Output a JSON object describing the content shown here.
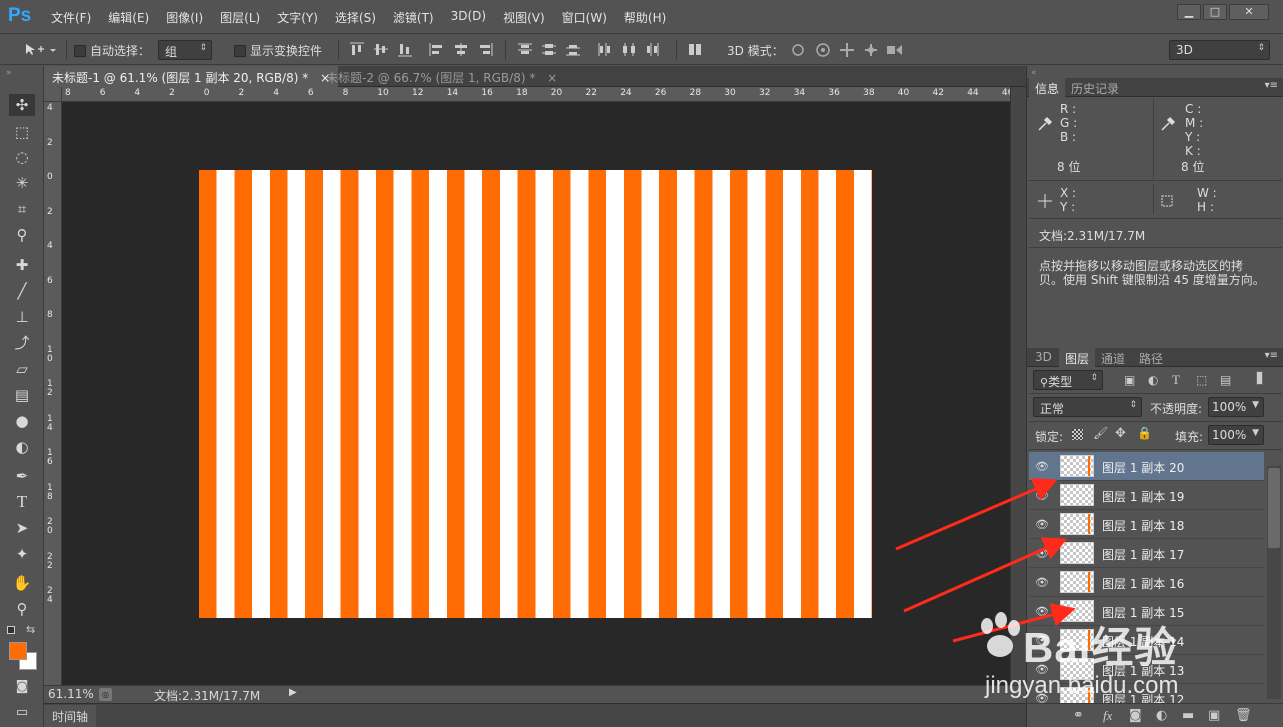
{
  "app": {
    "logo": "Ps"
  },
  "menu": [
    "文件(F)",
    "编辑(E)",
    "图像(I)",
    "图层(L)",
    "文字(Y)",
    "选择(S)",
    "滤镜(T)",
    "3D(D)",
    "视图(V)",
    "窗口(W)",
    "帮助(H)"
  ],
  "window_controls": {
    "minimize": "▁",
    "maximize": "□",
    "close": "✕"
  },
  "options": {
    "auto_select_label": "自动选择：",
    "auto_select_value": "组",
    "show_transform_label": "显示变换控件",
    "mode_3d_label": "3D 模式：",
    "workspace_value": "3D"
  },
  "doc_tabs": [
    {
      "title": "未标题-1 @ 61.1% (图层 1 副本 20, RGB/8) *",
      "close": "×",
      "active": true
    },
    {
      "title": "未标题-2 @ 66.7% (图层 1, RGB/8) *",
      "close": "×",
      "active": false
    }
  ],
  "ruler": {
    "h_labels": [
      "8",
      "6",
      "4",
      "2",
      "0",
      "2",
      "4",
      "6",
      "8",
      "10",
      "12",
      "14",
      "16",
      "18",
      "20",
      "22",
      "24",
      "26",
      "28",
      "30",
      "32",
      "34",
      "36",
      "38",
      "40",
      "42",
      "44",
      "46"
    ],
    "v_labels": [
      "4",
      "2",
      "0",
      "2",
      "4",
      "6",
      "8",
      "1\n0",
      "1\n2",
      "1\n4",
      "1\n6",
      "1\n8",
      "2\n0",
      "2\n2",
      "2\n4"
    ]
  },
  "status": {
    "zoom": "61.11%",
    "doc_size": "文档:2.31M/17.7M",
    "timeline_tab": "时间轴"
  },
  "info_panel": {
    "tabs": [
      "信息",
      "历史记录"
    ],
    "rgb": [
      "R :",
      "G :",
      "B :"
    ],
    "cmyk": [
      "C :",
      "M :",
      "Y :",
      "K :"
    ],
    "bits_left": "8 位",
    "bits_right": "8 位",
    "xy": [
      "X :",
      "Y :"
    ],
    "wh": [
      "W :",
      "H :"
    ],
    "doc_size": "文档:2.31M/17.7M",
    "hint_line1": "点按并拖移以移动图层或移动选区的拷",
    "hint_line2": "贝。使用 Shift 键限制沿 45 度增量方向。"
  },
  "layers_panel": {
    "tabs": [
      "3D",
      "图层",
      "通道",
      "路径"
    ],
    "filter_kind": "类型",
    "blend_mode": "正常",
    "opacity_label": "不透明度:",
    "opacity_value": "100%",
    "lock_label": "锁定:",
    "fill_label": "填充:",
    "fill_value": "100%",
    "layers": [
      {
        "name": "图层 1 副本 20",
        "selected": true
      },
      {
        "name": "图层 1 副本 19",
        "selected": false
      },
      {
        "name": "图层 1 副本 18",
        "selected": false
      },
      {
        "name": "图层 1 副本 17",
        "selected": false
      },
      {
        "name": "图层 1 副本 16",
        "selected": false
      },
      {
        "name": "图层 1 副本 15",
        "selected": false
      },
      {
        "name": "图层 1 副本 14",
        "selected": false
      },
      {
        "name": "图层 1 副本 13",
        "selected": false
      },
      {
        "name": "图层 1 副本 12",
        "selected": false
      }
    ],
    "footer_icons": [
      "link-icon",
      "fx-icon",
      "mask-icon",
      "adjustment-icon",
      "folder-icon",
      "new-layer-icon",
      "trash-icon"
    ]
  },
  "canvas": {
    "stripe_colors": [
      "#ff6c04",
      "#ffffff"
    ]
  },
  "watermark": {
    "brand": "Bai经验",
    "url": "jingyan.baidu.com"
  },
  "colors": {
    "foreground": "#ff6c04",
    "background": "#ffffff",
    "accent": "#ff2a1a"
  }
}
